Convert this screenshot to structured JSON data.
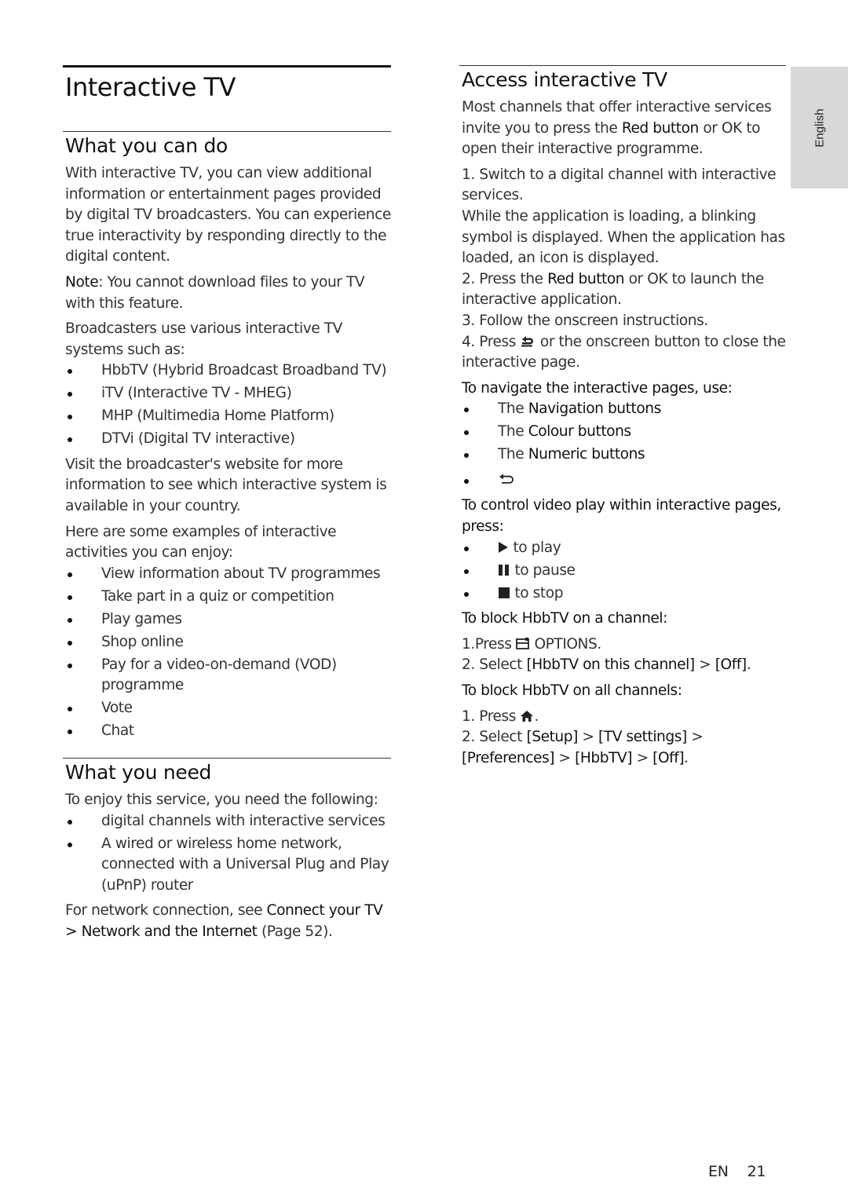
{
  "page_title": "Interactive TV",
  "language_tab": "English",
  "footer": {
    "lang": "EN",
    "page_number": "21"
  },
  "left": {
    "what_you_can_do": {
      "heading": "What you can do",
      "intro": "With interactive TV, you can view additional information or entertainment pages provided by digital TV broadcasters. You can experience true interactivity by responding directly to the digital content.",
      "note_label": "Note",
      "note_text": ": You cannot download files to your TV with this feature.",
      "systems_intro": "Broadcasters use various interactive TV systems such as:",
      "systems": [
        "HbbTV (Hybrid Broadcast Broadband TV)",
        "iTV (Interactive TV - MHEG)",
        "MHP (Multimedia Home Platform)",
        "DTVi (Digital TV interactive)"
      ],
      "visit": "Visit the broadcaster's website for more information to see which interactive system is available in your country.",
      "examples_intro": "Here are some examples of interactive activities you can enjoy:",
      "examples": [
        "View information about TV programmes",
        "Take part in a quiz or competition",
        "Play games",
        "Shop online",
        "Pay for a video-on-demand (VOD) programme",
        "Vote",
        "Chat"
      ]
    },
    "what_you_need": {
      "heading": "What you need",
      "intro": "To enjoy this service, you need the following:",
      "items": [
        "digital channels with interactive services",
        "A wired or wireless home network, connected with a Universal Plug and Play (uPnP) router"
      ],
      "see_prefix": "For network connection, see ",
      "see_link": "Connect your TV > Network and the Internet",
      "see_suffix": " (Page 52)."
    }
  },
  "right": {
    "access": {
      "heading": "Access interactive TV",
      "intro_a": "Most channels that offer interactive services invite you to press the ",
      "intro_red": "Red button",
      "intro_b": " or OK to open their interactive programme.",
      "step1": "1. Switch to a digital channel with interactive services.",
      "step1_note": "While the application is loading, a blinking symbol is displayed. When the application has loaded, an icon is displayed.",
      "step2_a": "2. Press the ",
      "step2_red": "Red button",
      "step2_b": " or OK to launch the interactive application.",
      "step3": "3. Follow the onscreen instructions.",
      "step4_a": "4. Press ",
      "step4_b": " or the onscreen button to close the interactive page.",
      "navigate_intro": "To navigate the interactive pages, use:",
      "navigate_items": [
        {
          "prefix": "The ",
          "label": "Navigation buttons"
        },
        {
          "prefix": "The ",
          "label": "Colour buttons"
        },
        {
          "prefix": "The ",
          "label": "Numeric buttons"
        }
      ],
      "video_intro": "To control video play within interactive pages, press:",
      "video_items": [
        {
          "icon": "play-icon",
          "text": " to play"
        },
        {
          "icon": "pause-icon",
          "text": " to pause"
        },
        {
          "icon": "stop-icon",
          "text": " to stop"
        }
      ],
      "block_channel_intro": "To block HbbTV on a channel:",
      "block_channel_step1_a": "1.Press ",
      "block_channel_step1_b": " OPTIONS.",
      "block_channel_step2_a": "2. Select ",
      "block_channel_step2_b": "[HbbTV on this channel]",
      "block_channel_step2_c": " > ",
      "block_channel_step2_d": "[Off]",
      "block_channel_step2_e": ".",
      "block_all_intro": "To block HbbTV on all channels:",
      "block_all_step1_a": "1. Press ",
      "block_all_step1_b": ".",
      "block_all_step2": {
        "prefix": "2. Select ",
        "path": [
          "[Setup]",
          "[TV settings]",
          "[Preferences]",
          "[HbbTV]",
          "[Off]"
        ],
        "sep": " > ",
        "suffix": "."
      }
    }
  }
}
